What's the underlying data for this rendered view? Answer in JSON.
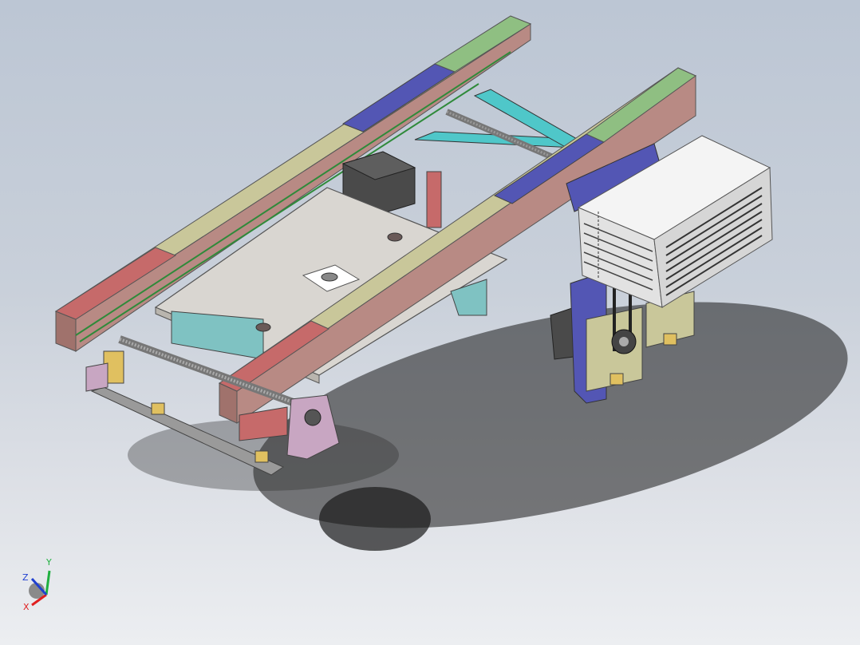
{
  "view": {
    "background_top": "#bcc6d4",
    "background_bottom": "#eceef1"
  },
  "model": {
    "colors": {
      "rail_red": "#c66a6a",
      "rail_khaki": "#c9c79a",
      "rail_blue": "#5356b4",
      "rail_green": "#8fbf82",
      "frame_body": "#b88a84",
      "plate": "#d9d6d1",
      "bracket_pink": "#c8a6c2",
      "shaft_cyan": "#4fc7c9",
      "motor_dark": "#4a4a4a",
      "enclosure": "#e8e8e8",
      "belt_green": "#2f8a3a",
      "teal_block": "#7fc2c2",
      "gear_block": "#8a8f5f"
    }
  },
  "triad": {
    "x_label": "X",
    "y_label": "Y",
    "z_label": "Z",
    "x_color": "#e02020",
    "y_color": "#20b040",
    "z_color": "#2040d0"
  }
}
